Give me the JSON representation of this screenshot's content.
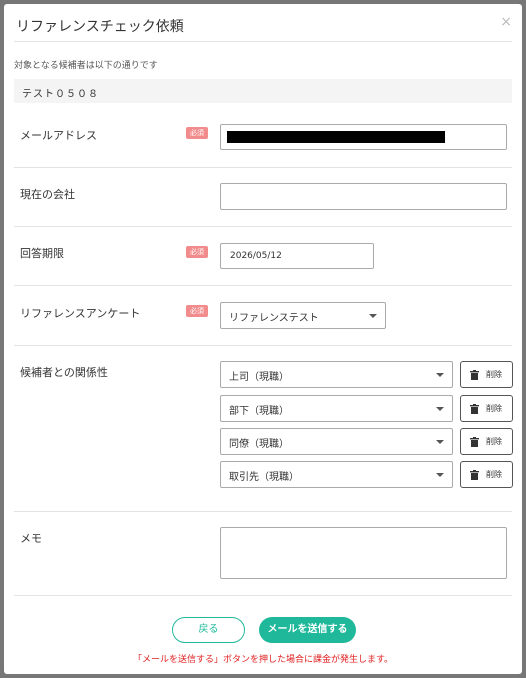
{
  "modal": {
    "title": "リファレンスチェック依頼",
    "close_label": "×"
  },
  "candidate": {
    "intro": "対象となる候補者は以下の通りです",
    "name": "テスト０５０８"
  },
  "required_badge": "必須",
  "fields": {
    "email": {
      "label": "メールアドレス",
      "value_masked": true
    },
    "company": {
      "label": "現在の会社",
      "value": ""
    },
    "deadline": {
      "label": "回答期限",
      "value": "2026/05/12"
    },
    "survey": {
      "label": "リファレンスアンケート",
      "value": "リファレンステスト"
    },
    "relations": {
      "label": "候補者との関係性",
      "items": [
        "上司（現職）",
        "部下（現職）",
        "同僚（現職）",
        "取引先（現職）"
      ],
      "delete_label": "削除"
    },
    "memo": {
      "label": "メモ",
      "value": ""
    }
  },
  "actions": {
    "back_label": "戻る",
    "send_label": "メールを送信する",
    "notice": "「メールを送信する」ボタンを押した場合に課金が発生します。"
  },
  "colors": {
    "accent": "#1fb89a",
    "required": "#f28b8b",
    "notice": "#e02020"
  }
}
